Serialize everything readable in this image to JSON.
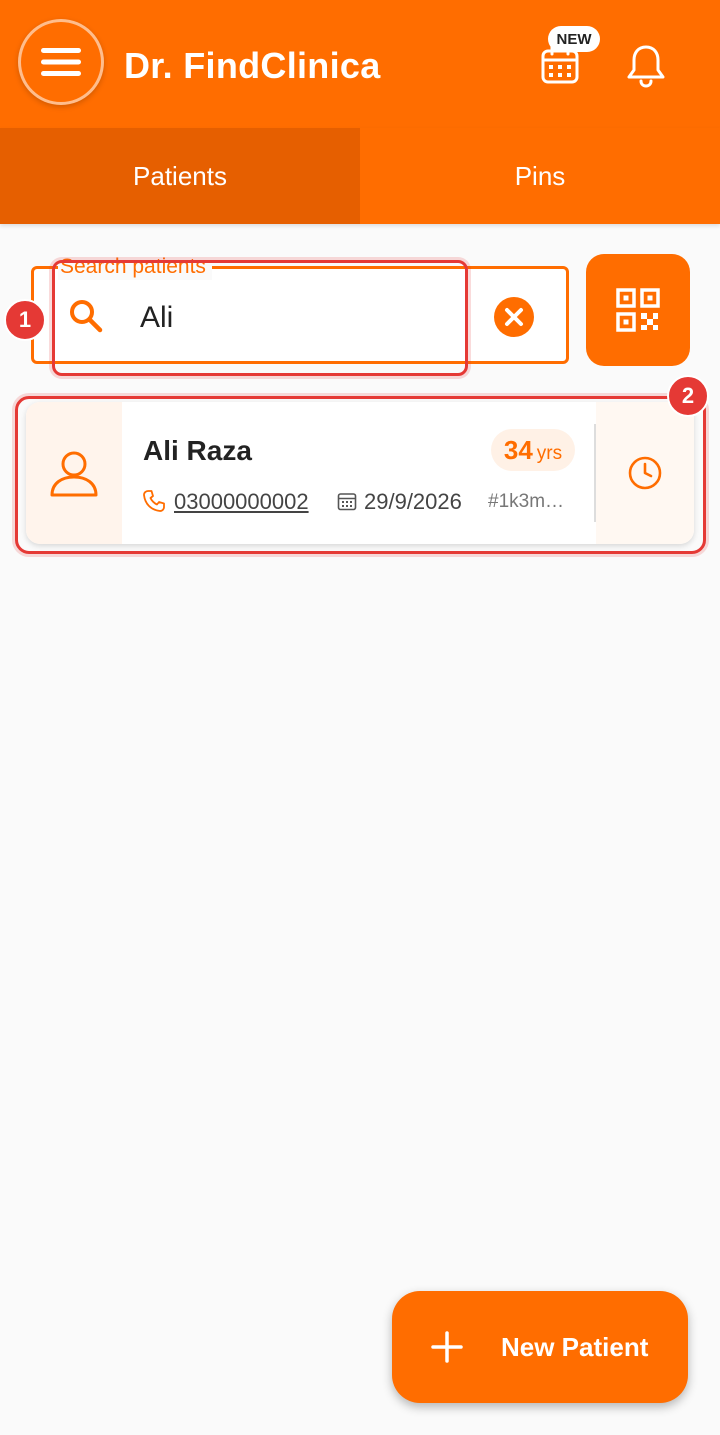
{
  "header": {
    "title": "Dr. FindClinica",
    "new_badge": "NEW",
    "background_color": "#ff6d00",
    "icons": {
      "menu": "menu-icon",
      "calendar": "calendar-icon",
      "notifications": "bell-icon"
    }
  },
  "tabs": [
    {
      "label": "Patients",
      "active": true
    },
    {
      "label": "Pins",
      "active": false
    }
  ],
  "search": {
    "label": "Search patients",
    "value": "Ali",
    "icons": {
      "search": "search-icon",
      "clear": "clear-icon",
      "scan": "qr-code-icon"
    }
  },
  "annotations": {
    "badge_1": "1",
    "badge_2": "2",
    "color": "#e53935"
  },
  "patients": [
    {
      "name": "Ali Raza",
      "age": "34",
      "age_unit": "yrs",
      "phone": "03000000002",
      "date": "29/9/2026",
      "id": "#1k3m…",
      "icons": {
        "avatar": "person-icon",
        "phone": "phone-icon",
        "date": "calendar-icon",
        "history": "clock-icon"
      }
    }
  ],
  "fab": {
    "label": "New Patient",
    "icon": "plus-icon"
  },
  "colors": {
    "accent": "#ff6d00",
    "active_tab": "#e65f00",
    "background": "#fafafa"
  }
}
